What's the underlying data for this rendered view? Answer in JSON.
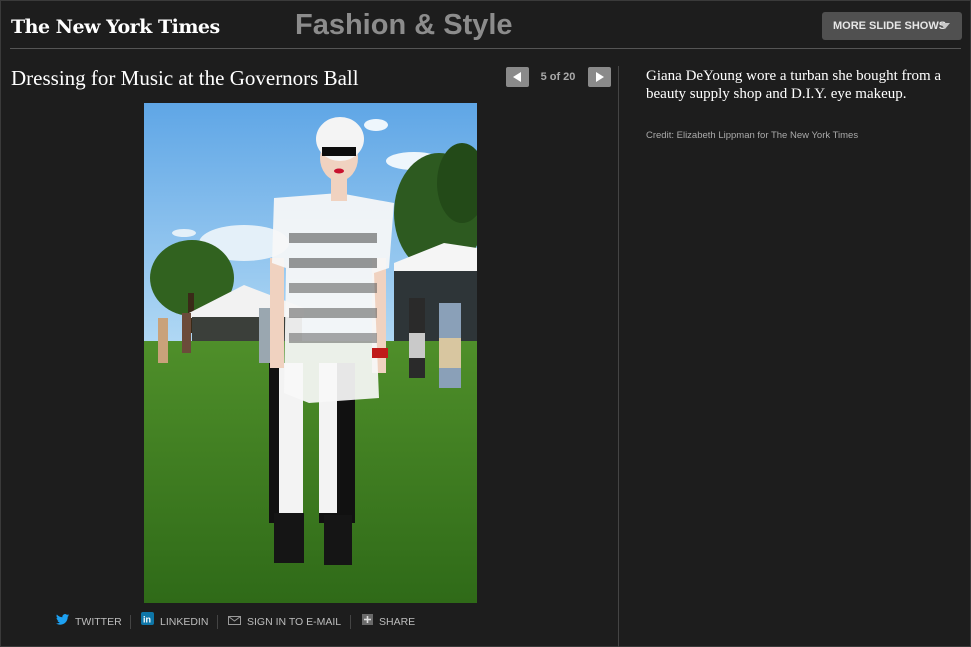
{
  "header": {
    "logo": "The New York Times",
    "section": "Fashion & Style",
    "more_button": "MORE SLIDE SHOWS"
  },
  "slideshow": {
    "title": "Dressing for Music at the Governors Ball",
    "counter": "5 of 20",
    "caption": "Giana DeYoung wore a turban she bought from a beauty supply shop and D.I.Y. eye makeup.",
    "credit": "Credit: Elizabeth Lippman for The New York Times"
  },
  "share": {
    "twitter": "TWITTER",
    "linkedin": "LINKEDIN",
    "email": "SIGN IN TO E-MAIL",
    "share": "SHARE"
  },
  "colors": {
    "background": "#1d1d1d",
    "section_title": "#8c8c8c",
    "twitter_blue": "#1da1f2",
    "linkedin_blue": "#0e76a8"
  }
}
